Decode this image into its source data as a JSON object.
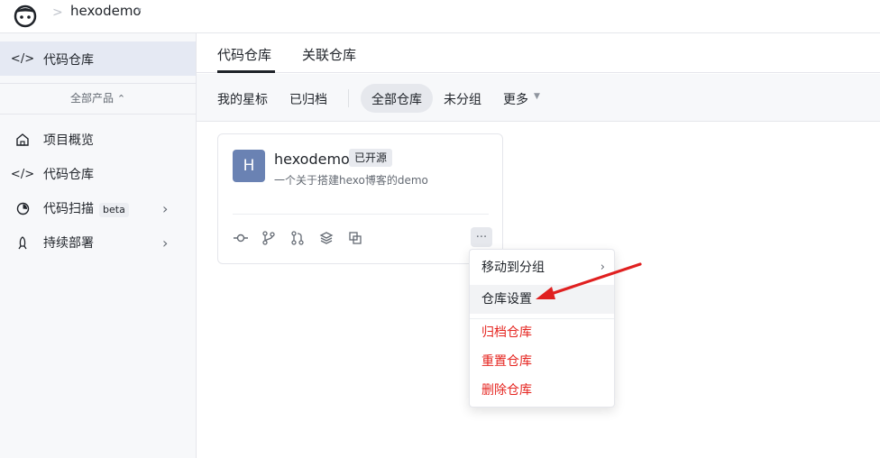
{
  "topbar": {
    "project_name": "hexodemo",
    "separator": ">",
    "caret": "▾"
  },
  "sidebar": {
    "active_item": "代码仓库",
    "all_products": "全部产品",
    "items": [
      {
        "label": "项目概览",
        "icon": "home-icon"
      },
      {
        "label": "代码仓库",
        "icon": "code-icon"
      },
      {
        "label": "代码扫描",
        "icon": "scan-icon",
        "badge": "beta"
      },
      {
        "label": "持续部署",
        "icon": "rocket-icon"
      }
    ]
  },
  "tabs": [
    {
      "label": "代码仓库",
      "active": true
    },
    {
      "label": "关联仓库",
      "active": false
    }
  ],
  "filters": {
    "starred": "我的星标",
    "archived": "已归档",
    "all": "全部仓库",
    "ungrouped": "未分组",
    "more": "更多"
  },
  "repo_card": {
    "avatar_letter": "H",
    "name": "hexodemo",
    "badge": "已开源",
    "description": "一个关于搭建hexo博客的demo",
    "more": "···",
    "icons": [
      "commit-icon",
      "branch-icon",
      "merge-request-icon",
      "layers-icon",
      "copy-icon"
    ]
  },
  "context_menu": {
    "move_group": "移动到分组",
    "settings": "仓库设置",
    "archive": "归档仓库",
    "reset": "重置仓库",
    "delete": "删除仓库"
  },
  "colors": {
    "accent_dark": "#1f2329",
    "danger": "#e5241f",
    "avatar": "#6a82b3",
    "annotation_arrow": "#e02020"
  }
}
